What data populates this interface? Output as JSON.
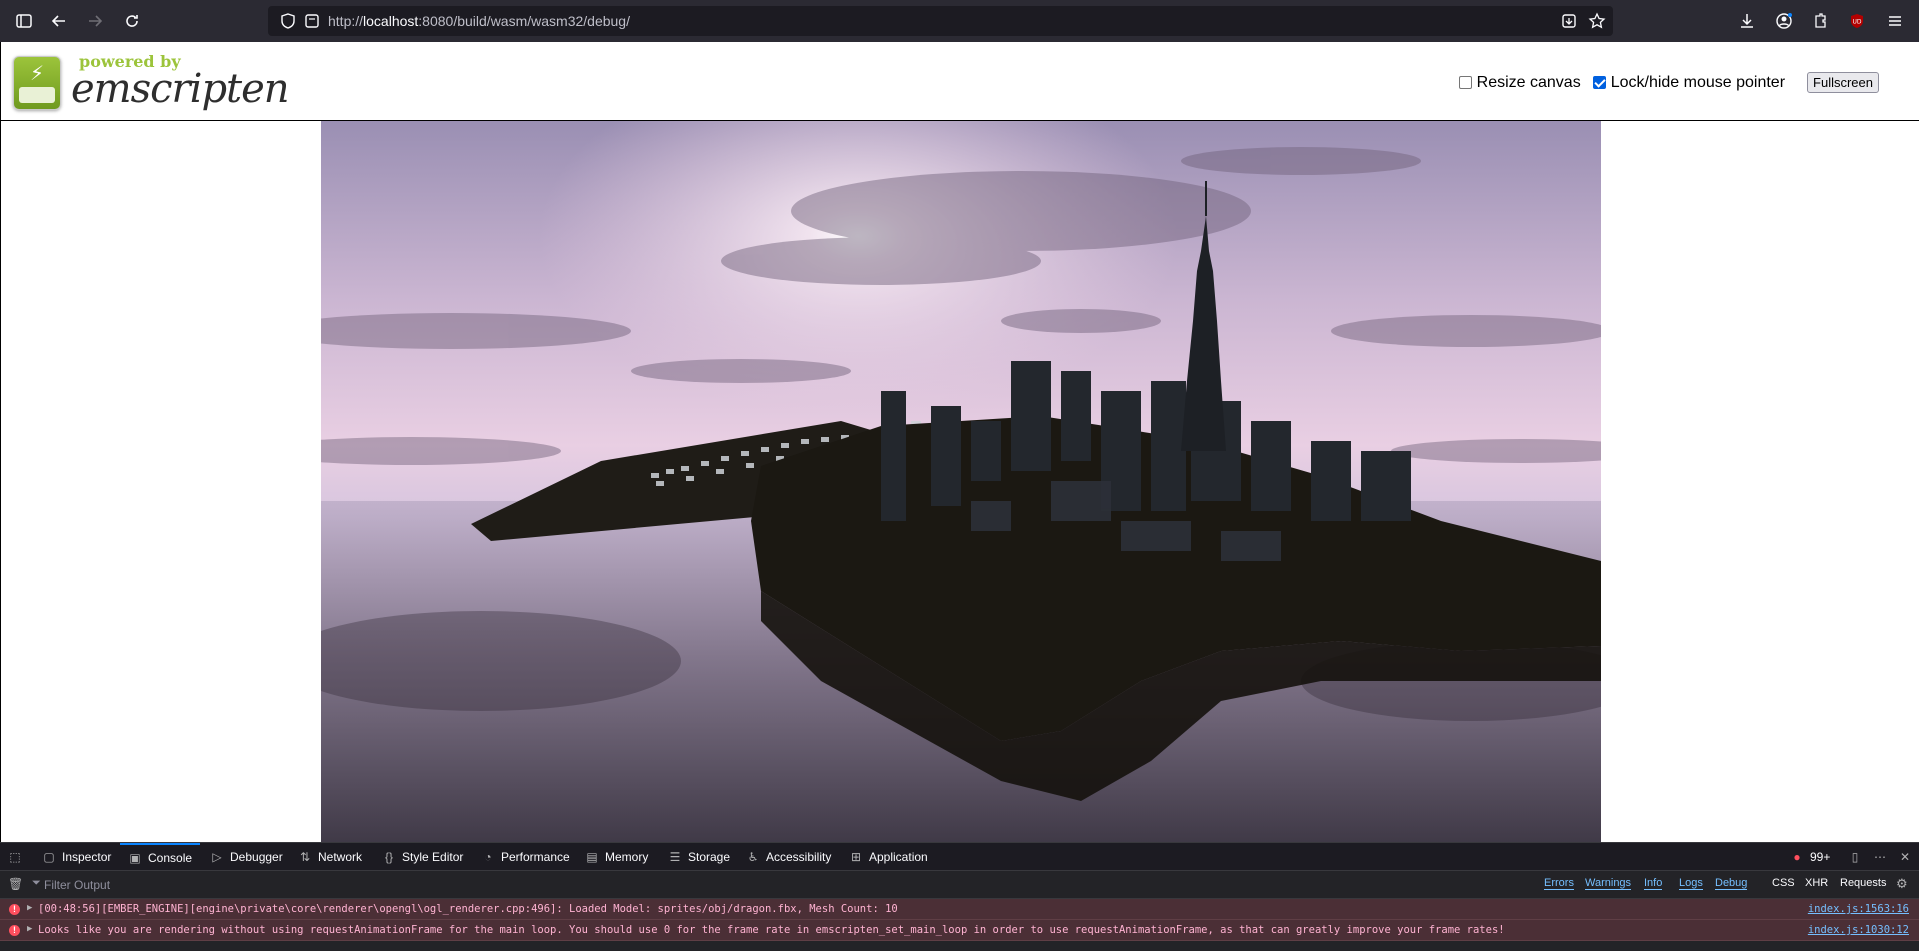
{
  "browser": {
    "url_scheme": "http://",
    "url_host": "localhost",
    "url_rest": ":8080/build/wasm/wasm32/debug/"
  },
  "header": {
    "logo_powered": "powered by",
    "logo_brand": "emscripten",
    "resize_canvas_label": "Resize canvas",
    "resize_canvas_checked": false,
    "lock_pointer_label": "Lock/hide mouse pointer",
    "lock_pointer_checked": true,
    "fullscreen_label": "Fullscreen"
  },
  "devtools": {
    "tabs": [
      "Inspector",
      "Console",
      "Debugger",
      "Network",
      "Style Editor",
      "Performance",
      "Memory",
      "Storage",
      "Accessibility",
      "Application"
    ],
    "active_tab": "Console",
    "error_count": "99+",
    "filter_placeholder": "Filter Output",
    "filters": [
      "Errors",
      "Warnings",
      "Info",
      "Logs",
      "Debug",
      "CSS",
      "XHR",
      "Requests"
    ],
    "messages": [
      {
        "text": "[00:48:56][EMBER_ENGINE][engine\\private\\core\\renderer\\opengl\\ogl_renderer.cpp:496]: Loaded Model: sprites/obj/dragon.fbx, Mesh Count:  10",
        "location": "index.js:1563:16"
      },
      {
        "text": "Looks like you are rendering without using requestAnimationFrame for the main loop. You should use 0 for the frame rate in emscripten_set_main_loop in order to use requestAnimationFrame, as that can greatly improve your frame rates!",
        "location": "index.js:1030:12"
      }
    ]
  },
  "colors": {
    "accent": "#0a84ff",
    "error_bg": "#4b2f36",
    "emscripten_green": "#9cc43b"
  }
}
